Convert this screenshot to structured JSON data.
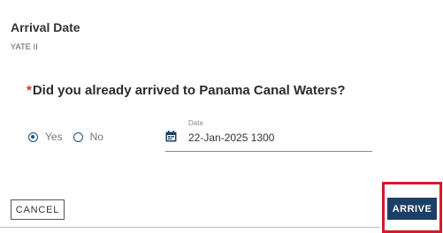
{
  "header": {
    "title": "Arrival Date",
    "subtitle": "YATE II"
  },
  "question": {
    "required_marker": "*",
    "text": "Did you already arrived to Panama Canal Waters?"
  },
  "answer": {
    "options": [
      {
        "label": "Yes",
        "selected": true
      },
      {
        "label": "No",
        "selected": false
      }
    ]
  },
  "date_field": {
    "label": "Date",
    "value": "22-Jan-2025 1300",
    "icon": "calendar-icon"
  },
  "actions": {
    "cancel_label": "CANCEL",
    "arrive_label": "ARRIVE"
  },
  "colors": {
    "primary": "#1b3f66",
    "required": "#d32f2f",
    "highlight": "#d8192b"
  }
}
